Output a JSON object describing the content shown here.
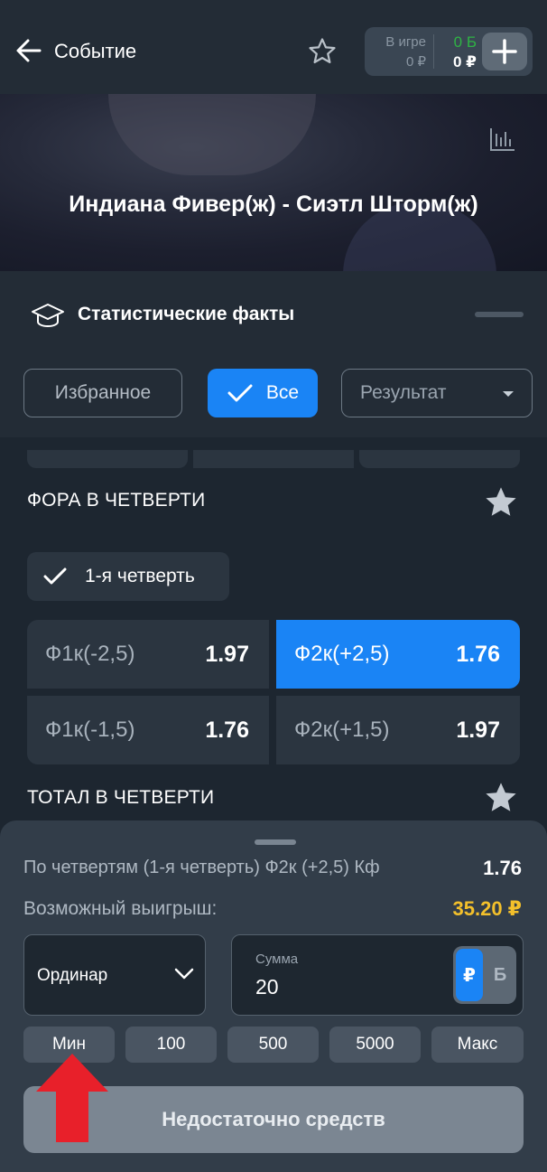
{
  "header": {
    "title": "Событие",
    "balance": {
      "in_game_label": "В игре",
      "in_game_value": "0 ₽",
      "bonus_value": "0 Б",
      "money_value": "0 ₽"
    }
  },
  "event": {
    "title": "Индиана Фивер(ж) - Сиэтл Шторм(ж)"
  },
  "stats_facts": {
    "label": "Статистические факты"
  },
  "filters": {
    "favorites": "Избранное",
    "all": "Все",
    "result": "Результат"
  },
  "markets": [
    {
      "title": "ФОРА В ЧЕТВЕРТИ",
      "quarter_chip": "1-я четверть",
      "odds": [
        {
          "label": "Ф1к(-2,5)",
          "value": "1.97",
          "selected": false
        },
        {
          "label": "Ф2к(+2,5)",
          "value": "1.76",
          "selected": true
        },
        {
          "label": "Ф1к(-1,5)",
          "value": "1.76",
          "selected": false
        },
        {
          "label": "Ф2к(+1,5)",
          "value": "1.97",
          "selected": false
        }
      ]
    },
    {
      "title": "ТОТАЛ В ЧЕТВЕРТИ"
    }
  ],
  "bet_slip": {
    "description": "По четвертям (1-я четверть) Ф2к (+2,5) Кф",
    "coefficient": "1.76",
    "win_label": "Возможный выигрыш:",
    "win_value": "35.20 ₽",
    "bet_type": "Ординар",
    "sum_label": "Сумма",
    "sum_value": "20",
    "currency_rub": "₽",
    "currency_bonus": "Б",
    "quick_amounts": [
      "Мин",
      "100",
      "500",
      "5000",
      "Макс"
    ],
    "submit_label": "Недостаточно средств"
  },
  "colors": {
    "accent": "#1a84f5",
    "win": "#f3c02b",
    "bonus": "#2fb344",
    "annotation_arrow": "#e8202a"
  }
}
